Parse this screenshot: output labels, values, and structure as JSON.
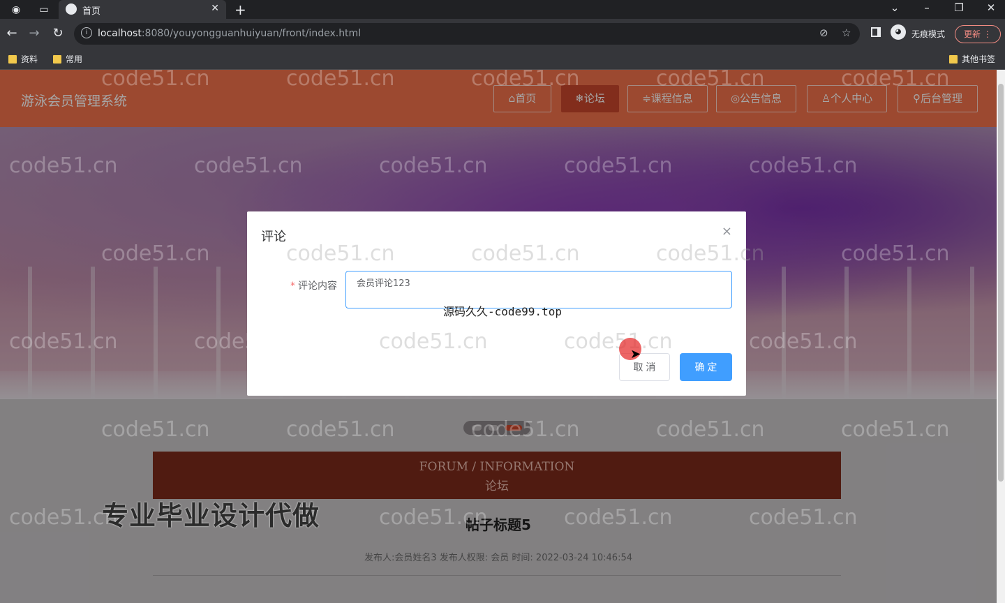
{
  "browser": {
    "tab_title": "首页",
    "url_host": "localhost",
    "url_path": ":8080/youyongguanhuiyuan/front/index.html",
    "incognito_label": "无痕模式",
    "update_label": "更新",
    "bookmarks": [
      "资料",
      "常用"
    ],
    "other_bookmarks": "其他书签"
  },
  "site": {
    "logo": "游泳会员管理系统",
    "nav": [
      {
        "label": "⌂首页"
      },
      {
        "label": "❄论坛"
      },
      {
        "label": "≑课程信息"
      },
      {
        "label": "◎公告信息"
      },
      {
        "label": "♙个人中心"
      },
      {
        "label": "⚲后台管理"
      }
    ]
  },
  "section": {
    "en": "FORUM / INFORMATION",
    "cn": "论坛"
  },
  "post": {
    "title": "帖子标题5",
    "meta": "发布人:会员姓名3   发布人权限: 会员   时间: 2022-03-24 10:46:54"
  },
  "dialog": {
    "title": "评论",
    "close": "×",
    "field_label": "评论内容",
    "required_mark": "*",
    "field_value": "会员评论123",
    "cancel": "取 消",
    "confirm": "确 定"
  },
  "overlays": {
    "watermark": "code51.cn",
    "caption1": "源码久久-code99.top",
    "caption2": "专业毕业设计代做"
  },
  "colors": {
    "header": "#f0714b",
    "nav_active": "#c8452b",
    "primary": "#409eff",
    "section_bar": "#7b2a1b"
  }
}
